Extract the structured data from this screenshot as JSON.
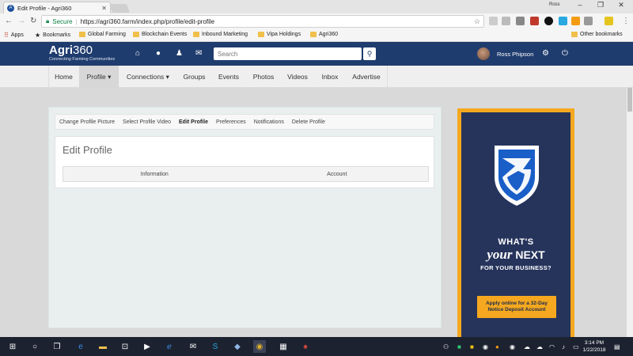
{
  "browser": {
    "tab_title": "Edit Profile - Agri360",
    "user": "Ross",
    "secure_label": "Secure",
    "url_host": "https://agri360.farm",
    "url_path": "/index.php/profile/edit-profile"
  },
  "bookmarks": [
    {
      "label": "Apps",
      "icon": "apps-icon"
    },
    {
      "label": "Bookmarks",
      "icon": "star-icon"
    },
    {
      "label": "Global Farming",
      "icon": "folder-icon"
    },
    {
      "label": "Blockchain Events",
      "icon": "folder-icon"
    },
    {
      "label": "Inbound Marketing",
      "icon": "folder-icon"
    },
    {
      "label": "Vipa Holdings",
      "icon": "folder-icon"
    },
    {
      "label": "Agri360",
      "icon": "folder-icon"
    }
  ],
  "other_bookmarks": "Other bookmarks",
  "site": {
    "logo_text": "Agri",
    "logo_num": "360",
    "tagline": "Connecting Farming Communities",
    "search_placeholder": "Search",
    "username": "Ross Phipson",
    "brand_color": "#1f3c6e"
  },
  "nav": [
    "Home",
    "Profile ▾",
    "Connections ▾",
    "Groups",
    "Events",
    "Photos",
    "Videos",
    "Inbox",
    "Advertise"
  ],
  "subnav": [
    "Change Profile Picture",
    "Select Profile Video",
    "Edit Profile",
    "Preferences",
    "Notifications",
    "Delete Profile"
  ],
  "card": {
    "title": "Edit Profile",
    "tabs": [
      "Information",
      "Account"
    ]
  },
  "ad": {
    "line1": "WHAT'S",
    "line2a": "your",
    "line2b": "NEXT",
    "line3": "FOR YOUR BUSINESS?",
    "cta_line1": "Apply online for a 32-Day",
    "cta_line2": "Notice Deposit Account"
  },
  "taskbar": {
    "time": "3:14 PM",
    "date": "1/22/2018"
  }
}
